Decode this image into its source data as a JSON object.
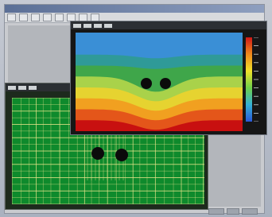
{
  "colors": {
    "desktop": "#aeb6c4",
    "window_chrome": "#c9cbcf",
    "mesh_background": "#0e8a2c",
    "mesh_lines": "#e6e28a",
    "mesh_holes": "#0b0b0b",
    "contour_bands": [
      "#c81010",
      "#e4561a",
      "#f1a020",
      "#e6d330",
      "#a9d24a",
      "#3fa64a",
      "#2f9a98",
      "#3a8fd6"
    ],
    "colorbar": [
      "#d01818",
      "#ef8a1c",
      "#f1e22a",
      "#6fd04a",
      "#35b2d6",
      "#2b58d8"
    ]
  },
  "back_window": {
    "icons": [
      "toolbar-button",
      "toolbar-button",
      "toolbar-button",
      "toolbar-button",
      "toolbar-button",
      "toolbar-button",
      "toolbar-button",
      "toolbar-button"
    ]
  },
  "mesh_window": {
    "icons": [
      "toolbar-button",
      "toolbar-button",
      "toolbar-button"
    ],
    "holes": 2
  },
  "contour_window": {
    "icons": [
      "toolbar-button",
      "toolbar-button",
      "toolbar-button",
      "toolbar-button"
    ],
    "holes": 2
  },
  "status": {
    "cells": 3
  }
}
